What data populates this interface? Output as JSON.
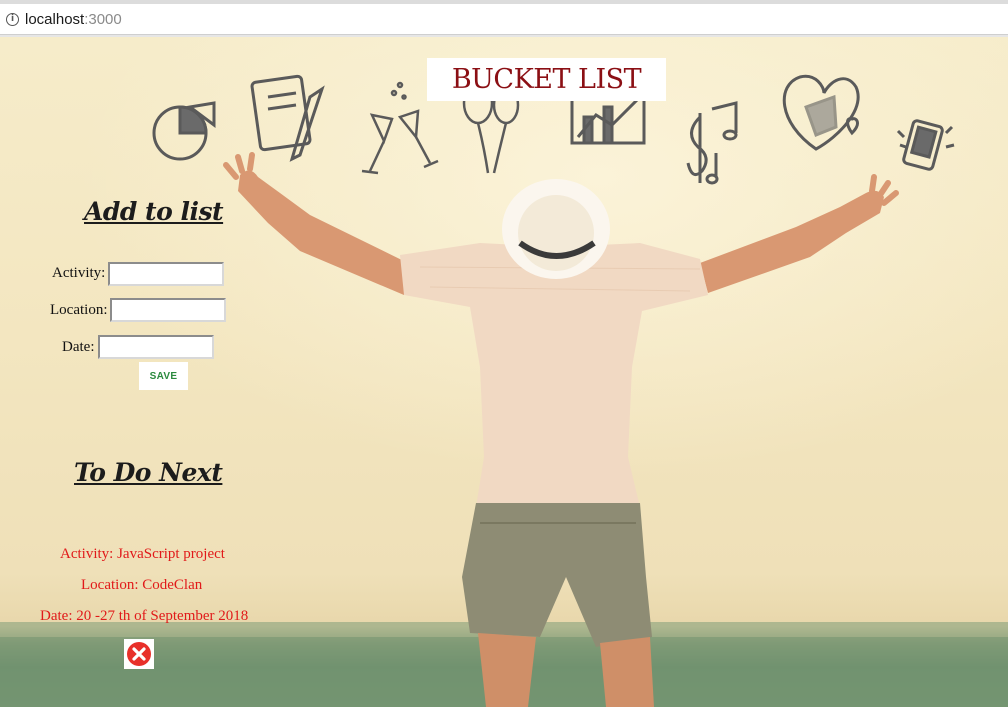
{
  "browser": {
    "url_host": "localhost",
    "url_port": ":3000",
    "info_glyph": "i"
  },
  "page": {
    "title": "BUCKET LIST"
  },
  "add_form": {
    "heading": "Add to list",
    "activity_label": "Activity:",
    "location_label": "Location:",
    "date_label": "Date:",
    "activity_value": "",
    "location_value": "",
    "date_value": "",
    "save_label": "SAVE"
  },
  "todo": {
    "heading": "To Do Next",
    "activity": "Activity: JavaScript project",
    "location": "Location: CodeClan",
    "date": "Date: 20 -27 th of September 2018"
  },
  "colors": {
    "title": "#8b0f14",
    "entry_text": "#e11a1a",
    "save_text": "#2b8a3e",
    "delete_icon": "#e8302a"
  },
  "icons": [
    "info-icon",
    "pie-chart-icon",
    "notebook-icon",
    "champagne-icon",
    "balloons-icon",
    "bar-chart-icon",
    "music-notes-icon",
    "heart-icon",
    "phone-icon",
    "delete-icon"
  ]
}
